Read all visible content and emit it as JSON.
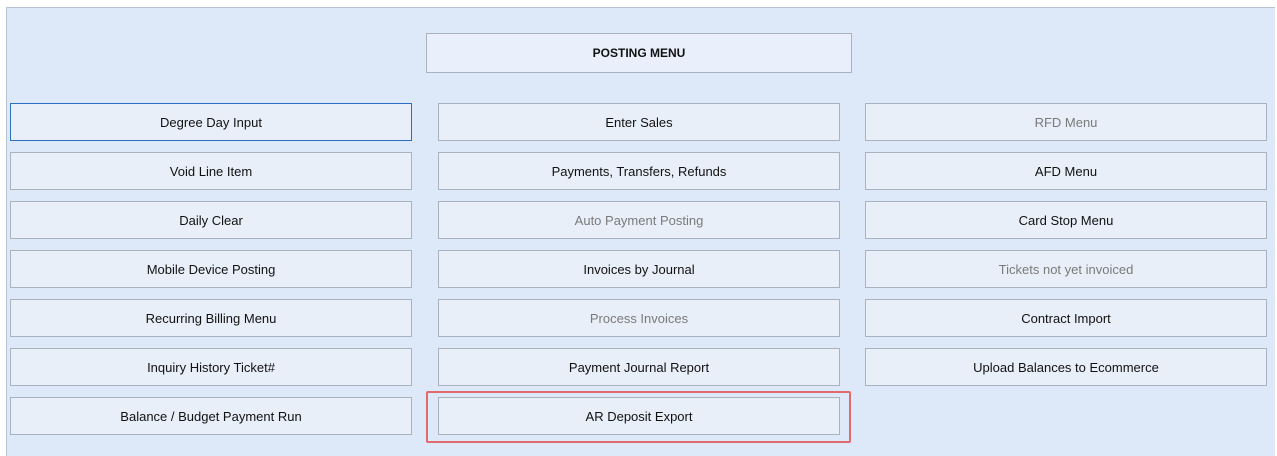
{
  "title": "POSTING MENU",
  "columns": [
    {
      "buttons": [
        {
          "label": "Degree Day Input",
          "enabled": true,
          "focused": true
        },
        {
          "label": "Void Line Item",
          "enabled": true
        },
        {
          "label": "Daily Clear",
          "enabled": true
        },
        {
          "label": "Mobile Device Posting",
          "enabled": true
        },
        {
          "label": "Recurring Billing Menu",
          "enabled": true
        },
        {
          "label": "Inquiry History Ticket#",
          "enabled": true
        },
        {
          "label": "Balance / Budget Payment Run",
          "enabled": true
        }
      ]
    },
    {
      "buttons": [
        {
          "label": "Enter Sales",
          "enabled": true
        },
        {
          "label": "Payments, Transfers, Refunds",
          "enabled": true
        },
        {
          "label": "Auto Payment Posting",
          "enabled": false
        },
        {
          "label": "Invoices by Journal",
          "enabled": true
        },
        {
          "label": "Process Invoices",
          "enabled": false
        },
        {
          "label": "Payment Journal Report",
          "enabled": true
        },
        {
          "label": "AR Deposit Export",
          "enabled": true,
          "highlighted": true
        }
      ]
    },
    {
      "buttons": [
        {
          "label": "RFD Menu",
          "enabled": false
        },
        {
          "label": "AFD Menu",
          "enabled": true
        },
        {
          "label": "Card Stop Menu",
          "enabled": true
        },
        {
          "label": "Tickets not yet invoiced",
          "enabled": false
        },
        {
          "label": "Contract Import",
          "enabled": true
        },
        {
          "label": "Upload Balances to Ecommerce",
          "enabled": true
        }
      ]
    }
  ],
  "colors": {
    "panel_bg": "#dde9f8",
    "button_bg": "#e8eff9",
    "button_border": "#a9b3bf",
    "focus_border": "#2a6fc1",
    "highlight_border": "#e06a6e",
    "disabled_text": "#7a7a7a"
  }
}
